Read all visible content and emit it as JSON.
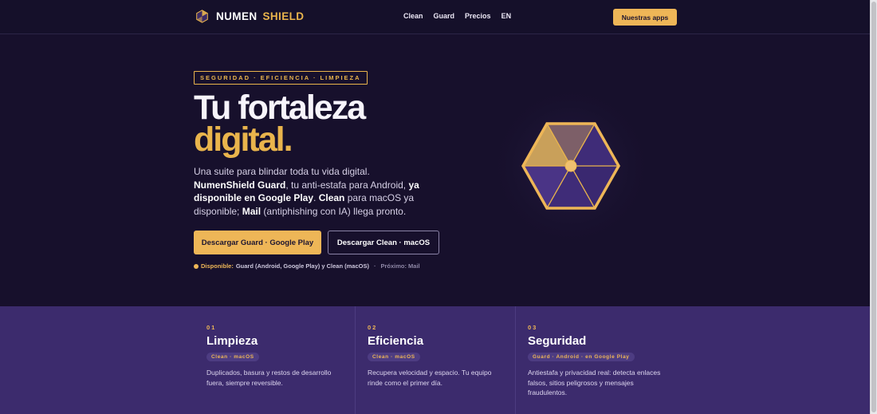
{
  "nav": {
    "brand_word1": "NUMEN",
    "brand_word2": "SHIELD",
    "links": [
      "Clean",
      "Guard",
      "Precios",
      "EN"
    ],
    "cta": "Nuestras apps"
  },
  "hero": {
    "eyebrow": "SEGURIDAD · EFICIENCIA · LIMPIEZA",
    "title_line1": "Tu fortaleza",
    "title_line2": "digital.",
    "lead": {
      "t1": "Una suite para blindar toda tu vida digital. ",
      "b1": "NumenShield Guard",
      "t2": ", tu anti-estafa para Android, ",
      "b2": "ya disponible en Google Play",
      "t3": ". ",
      "b3": "Clean",
      "t4": " para macOS ya disponible; ",
      "b4": "Mail",
      "t5": " (antiphishing con IA) llega pronto."
    },
    "primary_button": "Descargar Guard · Google Play",
    "secondary_button": "Descargar Clean · macOS",
    "availability": {
      "label": "Disponible:",
      "text": "Guard (Android, Google Play) y Clean (macOS)",
      "separator": "·",
      "next": "Próximo: Mail"
    }
  },
  "features": [
    {
      "number": "01",
      "title": "Limpieza",
      "badge": "Clean · macOS",
      "description": "Duplicados, basura y restos de desarrollo fuera, siempre reversible."
    },
    {
      "number": "02",
      "title": "Eficiencia",
      "badge": "Clean · macOS",
      "description": "Recupera velocidad y espacio. Tu equipo rinde como el primer día."
    },
    {
      "number": "03",
      "title": "Seguridad",
      "badge": "Guard · Android · en Google Play",
      "description": "Antiestafa y privacidad real: detecta enlaces falsos, sitios peligrosos y mensajes fraudulentos."
    }
  ],
  "colors": {
    "accent": "#eeb657",
    "background": "#17102c",
    "features_background": "#3c2b6d"
  }
}
